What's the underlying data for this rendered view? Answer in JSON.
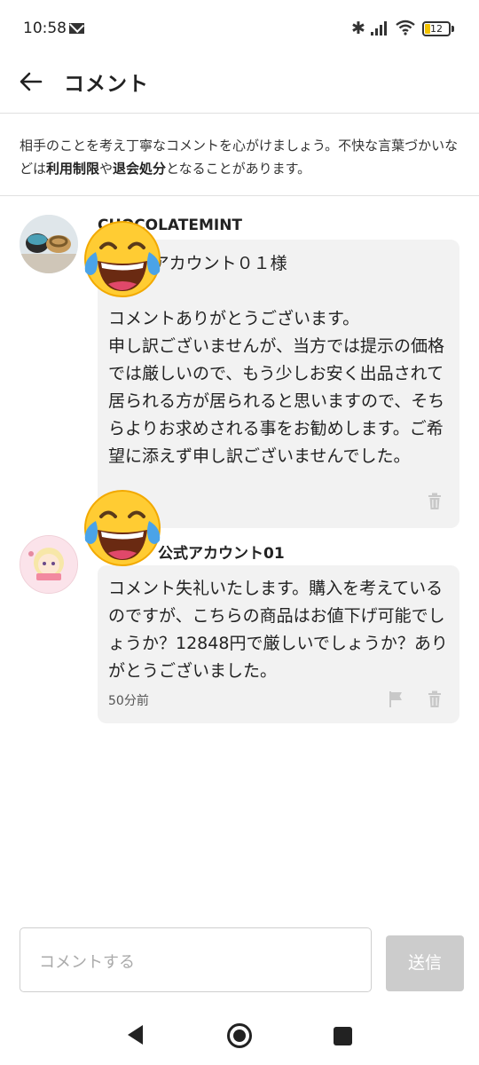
{
  "status_bar": {
    "time": "10:58",
    "battery": "12"
  },
  "header": {
    "title": "コメント"
  },
  "notice": {
    "part1": "相手のことを考え丁寧なコメントを心がけましょう。不快な言葉づかいなどは",
    "bold1": "利用制限",
    "part2": "や",
    "bold2": "退会処分",
    "part3": "となることがあります。"
  },
  "comments": [
    {
      "username": "CHOCOLATEMINT",
      "text": "o公式アカウント０１様\n\nコメントありがとうございます。\n申し訳ございませんが、当方では提示の価格では厳しいので、もう少しお安く出品されて居られる方が居られると思いますので、そちらよりお求めされる事をお勧めします。ご希望に添えず申し訳ございませんでした。",
      "timestamp": ""
    },
    {
      "username": "公式アカウント01",
      "text": "コメント失礼いたします。購入を考えているのですが、こちらの商品はお値下げ可能でしょうか？12848円で厳しいでしょうか？ありがとうございました。",
      "timestamp": "50分前"
    }
  ],
  "input": {
    "placeholder": "コメントする",
    "send_label": "送信"
  },
  "colors": {
    "bubble": "#f2f2f2",
    "send_disabled": "#cccccc",
    "divider": "#e0e0e0"
  },
  "icons": [
    "back-arrow-icon",
    "trash-icon",
    "flag-icon",
    "bluetooth-icon",
    "wifi-icon",
    "signal-icon",
    "battery-icon",
    "mail-icon",
    "tears-of-joy-emoji"
  ]
}
